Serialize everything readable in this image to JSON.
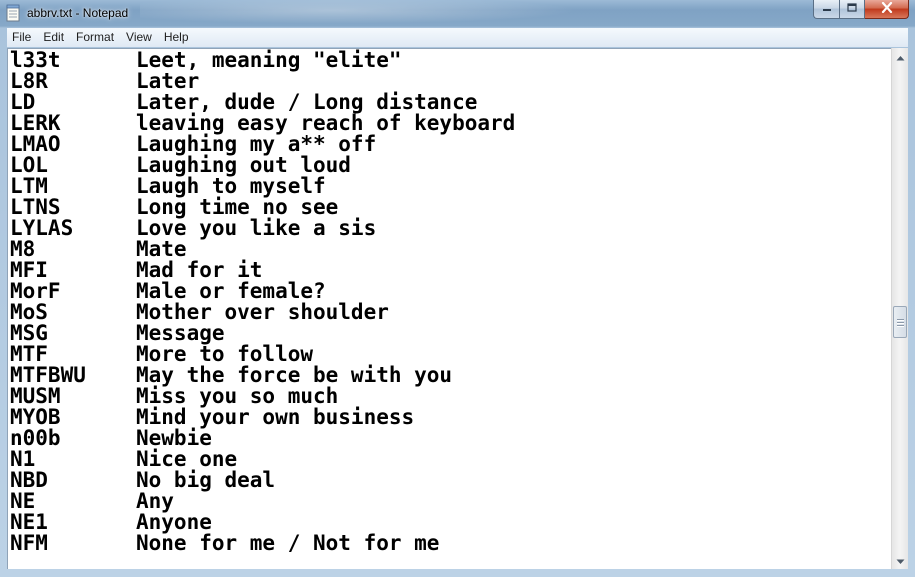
{
  "window": {
    "title": "abbrv.txt - Notepad"
  },
  "menu": [
    {
      "label": "File"
    },
    {
      "label": "Edit"
    },
    {
      "label": "Format"
    },
    {
      "label": "View"
    },
    {
      "label": "Help"
    }
  ],
  "lines": [
    {
      "abbr": "l33t",
      "desc": "Leet, meaning \"elite\""
    },
    {
      "abbr": "L8R",
      "desc": "Later"
    },
    {
      "abbr": "LD",
      "desc": "Later, dude / Long distance"
    },
    {
      "abbr": "LERK",
      "desc": "leaving easy reach of keyboard"
    },
    {
      "abbr": "LMAO",
      "desc": "Laughing my a** off"
    },
    {
      "abbr": "LOL",
      "desc": "Laughing out loud"
    },
    {
      "abbr": "LTM",
      "desc": "Laugh to myself"
    },
    {
      "abbr": "LTNS",
      "desc": "Long time no see"
    },
    {
      "abbr": "LYLAS",
      "desc": "Love you like a sis"
    },
    {
      "abbr": "M8",
      "desc": "Mate"
    },
    {
      "abbr": "MFI",
      "desc": "Mad for it"
    },
    {
      "abbr": "MorF",
      "desc": "Male or female?"
    },
    {
      "abbr": "MoS",
      "desc": "Mother over shoulder"
    },
    {
      "abbr": "MSG",
      "desc": "Message"
    },
    {
      "abbr": "MTF",
      "desc": "More to follow"
    },
    {
      "abbr": "MTFBWU",
      "desc": "May the force be with you"
    },
    {
      "abbr": "MUSM",
      "desc": "Miss you so much"
    },
    {
      "abbr": "MYOB",
      "desc": "Mind your own business"
    },
    {
      "abbr": "n00b",
      "desc": "Newbie"
    },
    {
      "abbr": "N1",
      "desc": "Nice one"
    },
    {
      "abbr": "NBD",
      "desc": "No big deal"
    },
    {
      "abbr": "NE",
      "desc": "Any"
    },
    {
      "abbr": "NE1",
      "desc": "Anyone"
    },
    {
      "abbr": "NFM",
      "desc": "None for me / Not for me"
    }
  ],
  "icons": {
    "app": "notepad-icon",
    "minimize": "minimize-icon",
    "maximize": "maximize-icon",
    "close": "close-icon",
    "scroll_up": "scroll-up-arrow-icon",
    "scroll_down": "scroll-down-arrow-icon"
  },
  "colors": {
    "close_button": "#c0391c",
    "frame": "#7fa2c4",
    "text": "#000000"
  }
}
